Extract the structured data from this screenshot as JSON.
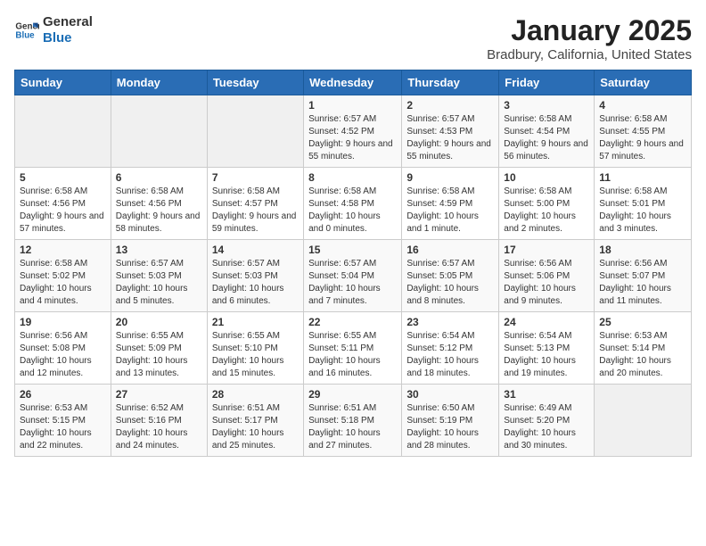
{
  "header": {
    "logo_line1": "General",
    "logo_line2": "Blue",
    "title": "January 2025",
    "subtitle": "Bradbury, California, United States"
  },
  "calendar": {
    "days_of_week": [
      "Sunday",
      "Monday",
      "Tuesday",
      "Wednesday",
      "Thursday",
      "Friday",
      "Saturday"
    ],
    "weeks": [
      [
        {
          "day": "",
          "info": ""
        },
        {
          "day": "",
          "info": ""
        },
        {
          "day": "",
          "info": ""
        },
        {
          "day": "1",
          "info": "Sunrise: 6:57 AM\nSunset: 4:52 PM\nDaylight: 9 hours and 55 minutes."
        },
        {
          "day": "2",
          "info": "Sunrise: 6:57 AM\nSunset: 4:53 PM\nDaylight: 9 hours and 55 minutes."
        },
        {
          "day": "3",
          "info": "Sunrise: 6:58 AM\nSunset: 4:54 PM\nDaylight: 9 hours and 56 minutes."
        },
        {
          "day": "4",
          "info": "Sunrise: 6:58 AM\nSunset: 4:55 PM\nDaylight: 9 hours and 57 minutes."
        }
      ],
      [
        {
          "day": "5",
          "info": "Sunrise: 6:58 AM\nSunset: 4:56 PM\nDaylight: 9 hours and 57 minutes."
        },
        {
          "day": "6",
          "info": "Sunrise: 6:58 AM\nSunset: 4:56 PM\nDaylight: 9 hours and 58 minutes."
        },
        {
          "day": "7",
          "info": "Sunrise: 6:58 AM\nSunset: 4:57 PM\nDaylight: 9 hours and 59 minutes."
        },
        {
          "day": "8",
          "info": "Sunrise: 6:58 AM\nSunset: 4:58 PM\nDaylight: 10 hours and 0 minutes."
        },
        {
          "day": "9",
          "info": "Sunrise: 6:58 AM\nSunset: 4:59 PM\nDaylight: 10 hours and 1 minute."
        },
        {
          "day": "10",
          "info": "Sunrise: 6:58 AM\nSunset: 5:00 PM\nDaylight: 10 hours and 2 minutes."
        },
        {
          "day": "11",
          "info": "Sunrise: 6:58 AM\nSunset: 5:01 PM\nDaylight: 10 hours and 3 minutes."
        }
      ],
      [
        {
          "day": "12",
          "info": "Sunrise: 6:58 AM\nSunset: 5:02 PM\nDaylight: 10 hours and 4 minutes."
        },
        {
          "day": "13",
          "info": "Sunrise: 6:57 AM\nSunset: 5:03 PM\nDaylight: 10 hours and 5 minutes."
        },
        {
          "day": "14",
          "info": "Sunrise: 6:57 AM\nSunset: 5:03 PM\nDaylight: 10 hours and 6 minutes."
        },
        {
          "day": "15",
          "info": "Sunrise: 6:57 AM\nSunset: 5:04 PM\nDaylight: 10 hours and 7 minutes."
        },
        {
          "day": "16",
          "info": "Sunrise: 6:57 AM\nSunset: 5:05 PM\nDaylight: 10 hours and 8 minutes."
        },
        {
          "day": "17",
          "info": "Sunrise: 6:56 AM\nSunset: 5:06 PM\nDaylight: 10 hours and 9 minutes."
        },
        {
          "day": "18",
          "info": "Sunrise: 6:56 AM\nSunset: 5:07 PM\nDaylight: 10 hours and 11 minutes."
        }
      ],
      [
        {
          "day": "19",
          "info": "Sunrise: 6:56 AM\nSunset: 5:08 PM\nDaylight: 10 hours and 12 minutes."
        },
        {
          "day": "20",
          "info": "Sunrise: 6:55 AM\nSunset: 5:09 PM\nDaylight: 10 hours and 13 minutes."
        },
        {
          "day": "21",
          "info": "Sunrise: 6:55 AM\nSunset: 5:10 PM\nDaylight: 10 hours and 15 minutes."
        },
        {
          "day": "22",
          "info": "Sunrise: 6:55 AM\nSunset: 5:11 PM\nDaylight: 10 hours and 16 minutes."
        },
        {
          "day": "23",
          "info": "Sunrise: 6:54 AM\nSunset: 5:12 PM\nDaylight: 10 hours and 18 minutes."
        },
        {
          "day": "24",
          "info": "Sunrise: 6:54 AM\nSunset: 5:13 PM\nDaylight: 10 hours and 19 minutes."
        },
        {
          "day": "25",
          "info": "Sunrise: 6:53 AM\nSunset: 5:14 PM\nDaylight: 10 hours and 20 minutes."
        }
      ],
      [
        {
          "day": "26",
          "info": "Sunrise: 6:53 AM\nSunset: 5:15 PM\nDaylight: 10 hours and 22 minutes."
        },
        {
          "day": "27",
          "info": "Sunrise: 6:52 AM\nSunset: 5:16 PM\nDaylight: 10 hours and 24 minutes."
        },
        {
          "day": "28",
          "info": "Sunrise: 6:51 AM\nSunset: 5:17 PM\nDaylight: 10 hours and 25 minutes."
        },
        {
          "day": "29",
          "info": "Sunrise: 6:51 AM\nSunset: 5:18 PM\nDaylight: 10 hours and 27 minutes."
        },
        {
          "day": "30",
          "info": "Sunrise: 6:50 AM\nSunset: 5:19 PM\nDaylight: 10 hours and 28 minutes."
        },
        {
          "day": "31",
          "info": "Sunrise: 6:49 AM\nSunset: 5:20 PM\nDaylight: 10 hours and 30 minutes."
        },
        {
          "day": "",
          "info": ""
        }
      ]
    ]
  }
}
